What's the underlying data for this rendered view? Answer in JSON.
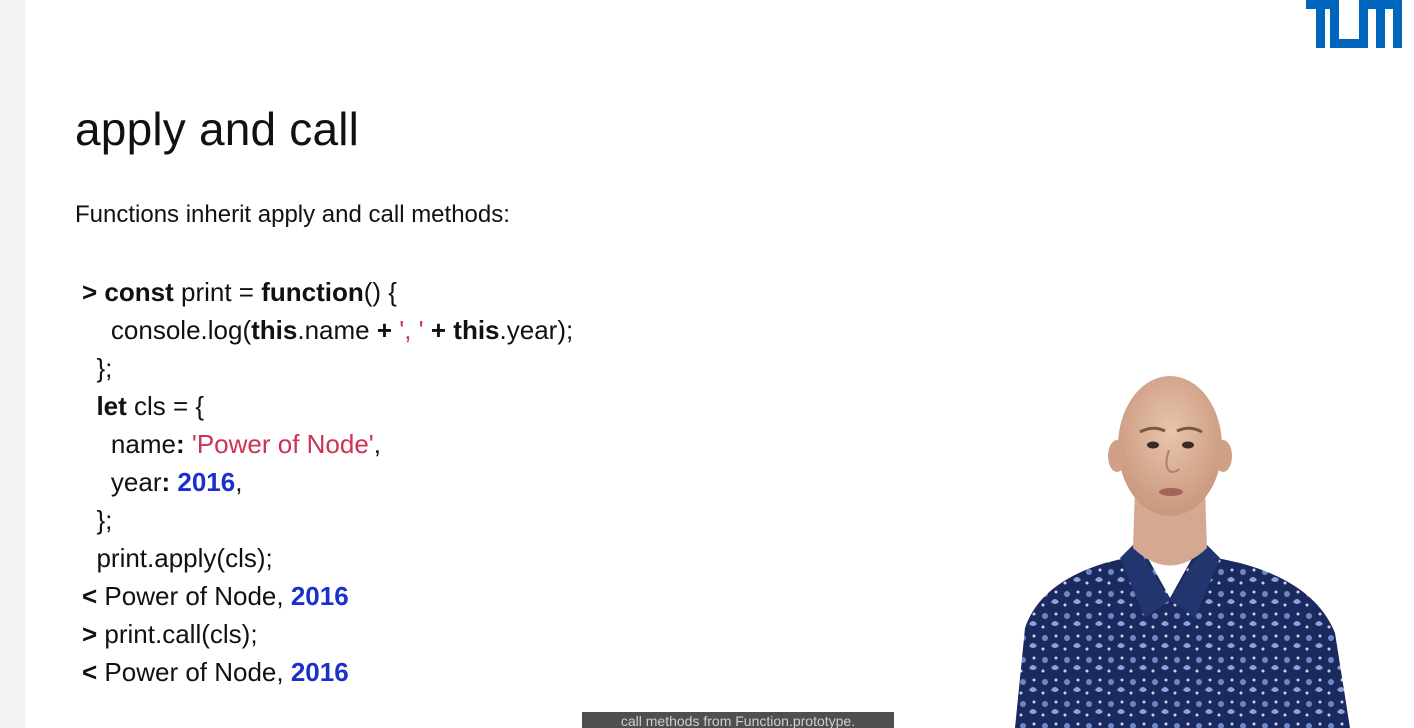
{
  "slide": {
    "title": "apply and call",
    "subtitle": "Functions inherit apply and call methods:",
    "logo_text": "TUM",
    "brand_color": "#0065bd",
    "code": {
      "l1": {
        "prefix": "> ",
        "kw1": "const",
        "t1": " print = ",
        "kw2": "function",
        "t2": "() {"
      },
      "l2": {
        "indent": "    ",
        "t1": "console.log(",
        "kw1": "this",
        "t2": ".name ",
        "op1": "+",
        "t3": " ",
        "str1": "', '",
        "t4": " ",
        "op2": "+",
        "t5": " ",
        "kw2": "this",
        "t6": ".year);"
      },
      "l3": {
        "text": "  };"
      },
      "l4": {
        "indent": "  ",
        "kw1": "let",
        "t1": " cls = {"
      },
      "l5": {
        "indent": "    ",
        "t1": "name",
        "colon": ":",
        "t2": " ",
        "str1": "'Power of Node'",
        "t3": ","
      },
      "l6": {
        "indent": "    ",
        "t1": "year",
        "colon": ":",
        "t2": " ",
        "num1": "2016",
        "t3": ","
      },
      "l7": {
        "text": "  };"
      },
      "l8": {
        "text": "  print.apply(cls);"
      },
      "l9": {
        "prefix": "<",
        "t1": " Power of Node, ",
        "num1": "2016"
      },
      "l10": {
        "prefix": ">",
        "t1": " print.call(cls);"
      },
      "l11": {
        "prefix": "<",
        "t1": " Power of Node, ",
        "num1": "2016"
      }
    }
  },
  "caption": {
    "text": "call methods from Function.prototype."
  },
  "colors": {
    "string": "#cc3355",
    "number": "#1a2fcc"
  }
}
